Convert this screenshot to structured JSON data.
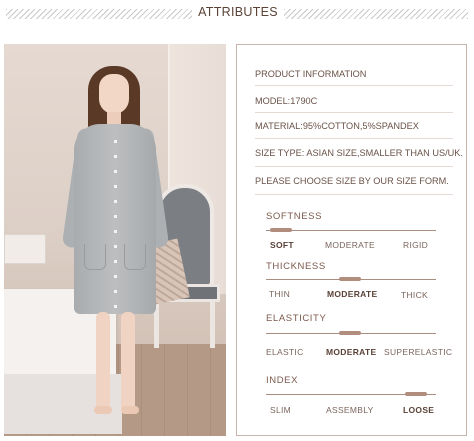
{
  "header": {
    "title": "ATTRIBUTES"
  },
  "product": {
    "info_title": "PRODUCT INFORMATION",
    "model": "MODEL:1790C",
    "material": "MATERIAL:95%COTTON,5%SPANDEX",
    "size_type": "SIZE TYPE: ASIAN SIZE,SMALLER THAN US/UK.",
    "note": "PLEASE CHOOSE SIZE BY OUR SIZE FORM."
  },
  "attributes": [
    {
      "title": "SOFTNESS",
      "options": [
        "SOFT",
        "MODERATE",
        "RIGID"
      ],
      "selected_index": 0
    },
    {
      "title": "THICKNESS",
      "options": [
        "THIN",
        "MODERATE",
        "THICK"
      ],
      "selected_index": 1
    },
    {
      "title": "ELASTICITY",
      "options": [
        "ELASTIC",
        "MODERATE",
        "SUPERELASTIC"
      ],
      "selected_index": 1
    },
    {
      "title": "INDEX",
      "options": [
        "SLIM",
        "ASSEMBLY",
        "LOOSE"
      ],
      "selected_index": 2
    }
  ],
  "colors": {
    "accent": "#b08d7d",
    "text": "#6a5248",
    "border": "#c8b4aa"
  }
}
